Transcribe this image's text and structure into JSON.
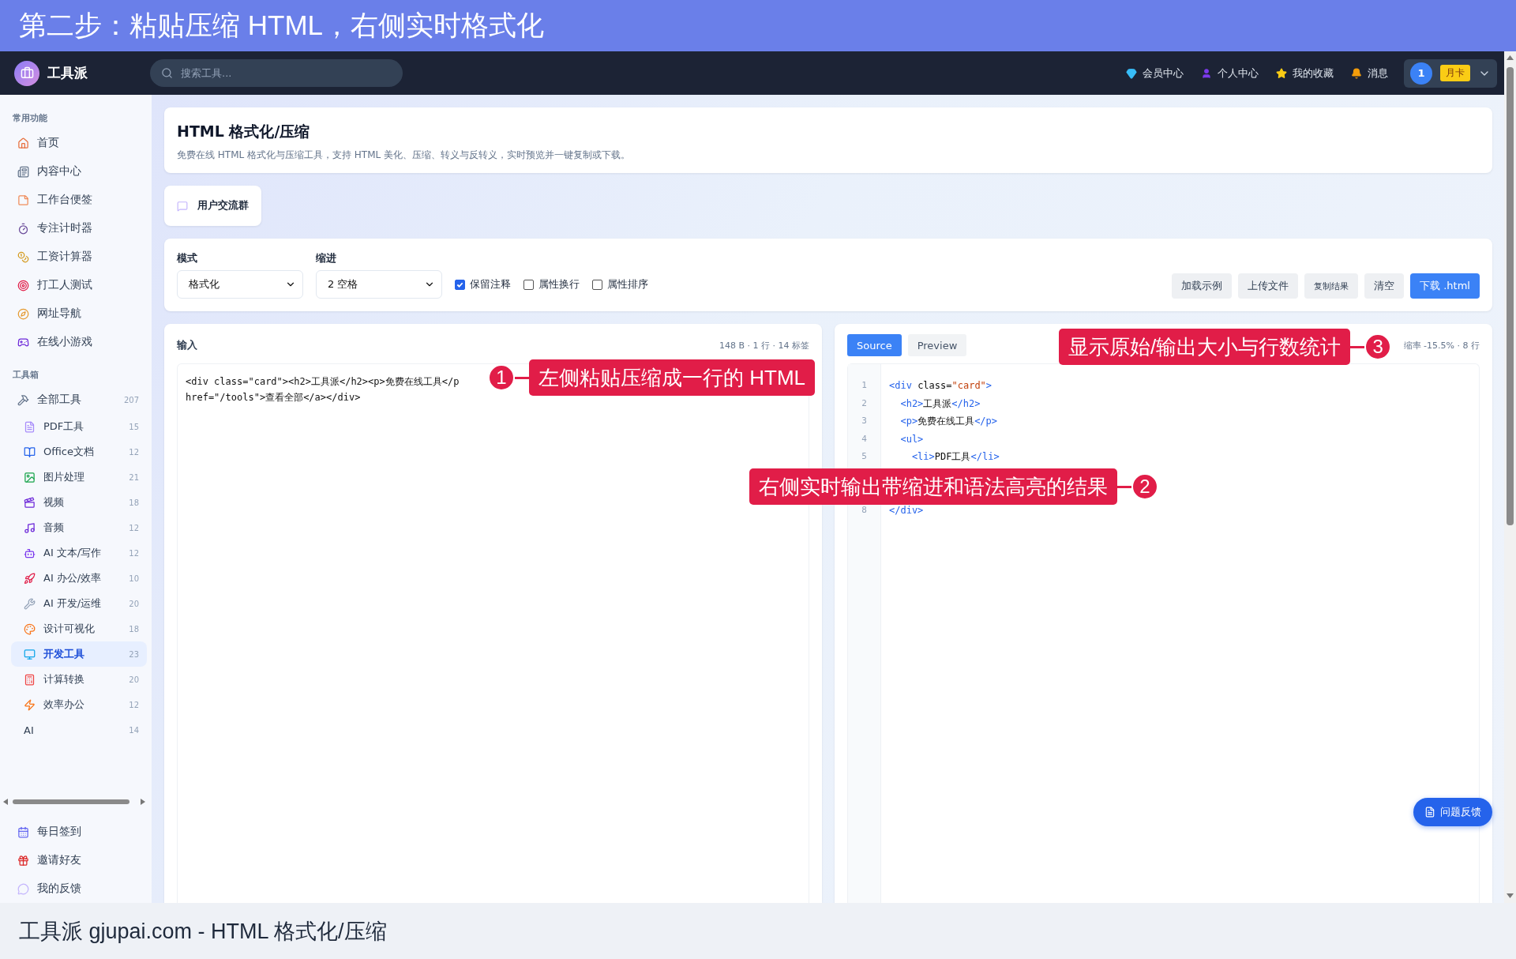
{
  "banner": {
    "title": "第二步：粘贴压缩 HTML，右侧实时格式化"
  },
  "nav": {
    "brand": "工具派",
    "search": {
      "placeholder": "搜索工具..."
    },
    "links": [
      "会员中心",
      "个人中心",
      "我的收藏",
      "消息"
    ],
    "user": {
      "avatar": "1",
      "badge": "月卡"
    }
  },
  "sidebar": {
    "sections": [
      {
        "title": "常用功能",
        "items": [
          {
            "label": "首页",
            "selected": false
          },
          {
            "label": "内容中心",
            "selected": false
          },
          {
            "label": "工作台便签",
            "selected": false
          },
          {
            "label": "专注计时器",
            "selected": false
          },
          {
            "label": "工资计算器",
            "selected": false
          },
          {
            "label": "打工人测试",
            "selected": false
          },
          {
            "label": "网址导航",
            "selected": false
          },
          {
            "label": "在线小游戏",
            "selected": false
          }
        ]
      },
      {
        "title": "工具箱",
        "items": [
          {
            "label": "全部工具",
            "count": "207",
            "selected": false,
            "children": [
              {
                "label": "PDF工具",
                "count": "15",
                "selected": false
              },
              {
                "label": "Office文档",
                "count": "12",
                "selected": false
              },
              {
                "label": "图片处理",
                "count": "21",
                "selected": false
              },
              {
                "label": "视频",
                "count": "18",
                "selected": false
              },
              {
                "label": "音频",
                "count": "12",
                "selected": false
              },
              {
                "label": "AI 文本/写作",
                "count": "12",
                "selected": false
              },
              {
                "label": "AI 办公/效率",
                "count": "10",
                "selected": false
              },
              {
                "label": "AI 开发/运维",
                "count": "20",
                "selected": false
              },
              {
                "label": "设计可视化",
                "count": "18",
                "selected": false
              },
              {
                "label": "开发工具",
                "count": "23",
                "selected": true
              },
              {
                "label": "计算转换",
                "count": "20",
                "selected": false
              },
              {
                "label": "效率办公",
                "count": "12",
                "selected": false
              },
              {
                "label": "AI",
                "count": "14",
                "selected": false
              }
            ]
          }
        ]
      }
    ],
    "bottom": [
      {
        "label": "每日签到",
        "selected": false
      },
      {
        "label": "邀请好友",
        "selected": false
      },
      {
        "label": "我的反馈",
        "selected": false
      }
    ]
  },
  "header": {
    "title": "HTML 格式化/压缩",
    "description": "免费在线 HTML 格式化与压缩工具，支持 HTML 美化、压缩、转义与反转义，实时预览并一键复制或下载。"
  },
  "community": {
    "label": "用户交流群"
  },
  "options": {
    "fields": [
      {
        "label": "模式",
        "value": "格式化"
      },
      {
        "label": "缩进",
        "value": "2 空格"
      }
    ],
    "checkboxes": [
      {
        "label": "保留注释",
        "checked": true
      },
      {
        "label": "属性换行",
        "checked": false
      },
      {
        "label": "属性排序",
        "checked": false
      }
    ],
    "buttons": [
      {
        "label": "加载示例",
        "kind": "default"
      },
      {
        "label": "上传文件",
        "kind": "default"
      },
      {
        "label": "复制结果",
        "kind": "small"
      },
      {
        "label": "清空",
        "kind": "default"
      },
      {
        "label": "下载 .html",
        "kind": "primary"
      }
    ]
  },
  "input": {
    "title": "输入",
    "stats": "148 B · 1 行 · 14 标签",
    "lines": [
      "<div class=\"card\"><h2>工具派</h2><p>免费在线工具</p",
      "href=\"/tools\">查看全部</a></div>"
    ]
  },
  "output": {
    "tabs": [
      {
        "label": "Source",
        "selected": true
      },
      {
        "label": "Preview",
        "selected": false
      }
    ],
    "stats": "缩率 -15.5% · 8 行",
    "lines": [
      {
        "number": "1",
        "tokens": [
          {
            "kind": "tag",
            "text": "<div"
          },
          {
            "kind": "attr",
            "text": " class="
          },
          {
            "kind": "string",
            "text": "\"card\""
          },
          {
            "kind": "tag",
            "text": ">"
          }
        ]
      },
      {
        "number": "2",
        "tokens": [
          {
            "kind": "tag",
            "text": "  <h2>"
          },
          {
            "kind": "text",
            "text": "工具派"
          },
          {
            "kind": "tag",
            "text": "</h2>"
          }
        ]
      },
      {
        "number": "3",
        "tokens": [
          {
            "kind": "tag",
            "text": "  <p>"
          },
          {
            "kind": "text",
            "text": "免费在线工具"
          },
          {
            "kind": "tag",
            "text": "</p>"
          }
        ]
      },
      {
        "number": "4",
        "tokens": [
          {
            "kind": "tag",
            "text": "  <ul>"
          }
        ]
      },
      {
        "number": "5",
        "tokens": [
          {
            "kind": "tag",
            "text": "    <li>"
          },
          {
            "kind": "text",
            "text": "PDF工具"
          },
          {
            "kind": "tag",
            "text": "</li>"
          }
        ]
      },
      {
        "number": "8",
        "tokens": [
          {
            "kind": "tag",
            "text": "</div>"
          }
        ]
      }
    ]
  },
  "feedback": {
    "label": "问题反馈"
  },
  "callouts": [
    {
      "number": "1",
      "text": "左侧粘贴压缩成一行的 HTML"
    },
    {
      "number": "2",
      "text": "右侧实时输出带缩进和语法高亮的结果"
    },
    {
      "number": "3",
      "text": "显示原始/输出大小与行数统计"
    }
  ],
  "footer": {
    "caption": "工具派 gjupai.com - HTML 格式化/压缩"
  }
}
